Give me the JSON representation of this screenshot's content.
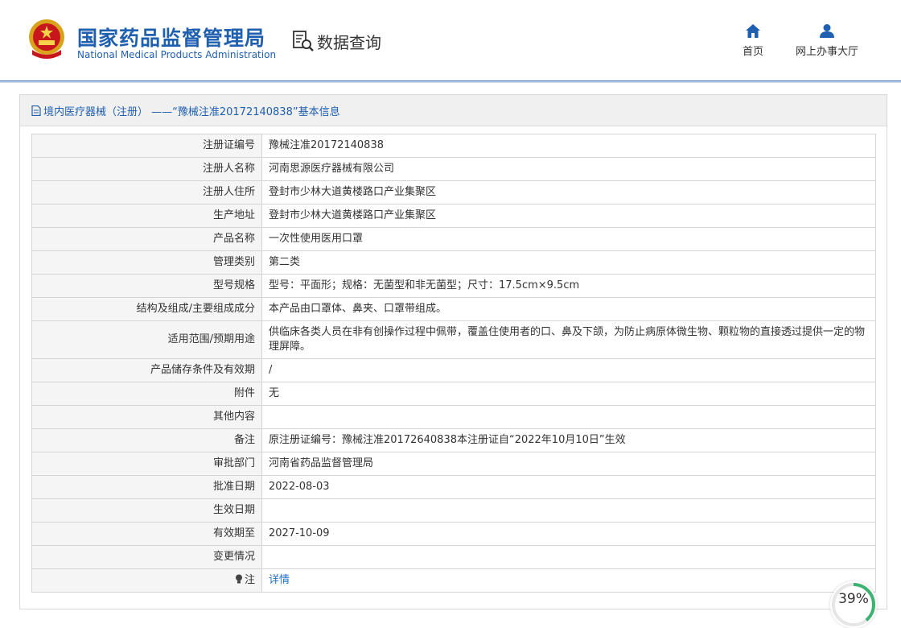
{
  "header": {
    "title_cn": "国家药品监督管理局",
    "title_en": "National Medical Products Administration",
    "section": "数据查询",
    "nav": [
      {
        "label": "首页",
        "icon": "home-icon"
      },
      {
        "label": "网上办事大厅",
        "icon": "user-icon"
      }
    ]
  },
  "panel": {
    "title": "境内医疗器械（注册） ——“豫械注准20172140838”基本信息"
  },
  "rows": [
    {
      "label": "注册证编号",
      "value": "豫械注准20172140838"
    },
    {
      "label": "注册人名称",
      "value": "河南思源医疗器械有限公司"
    },
    {
      "label": "注册人住所",
      "value": "登封市少林大道黄楼路口产业集聚区"
    },
    {
      "label": "生产地址",
      "value": "登封市少林大道黄楼路口产业集聚区"
    },
    {
      "label": "产品名称",
      "value": "一次性使用医用口罩"
    },
    {
      "label": "管理类别",
      "value": "第二类"
    },
    {
      "label": "型号规格",
      "value": "型号：平面形；规格：无菌型和非无菌型；尺寸：17.5cm×9.5cm"
    },
    {
      "label": "结构及组成/主要组成成分",
      "value": "本产品由口罩体、鼻夹、口罩带组成。"
    },
    {
      "label": "适用范围/预期用途",
      "value": "供临床各类人员在非有创操作过程中佩带，覆盖住使用者的口、鼻及下颌，为防止病原体微生物、颗粒物的直接透过提供一定的物理屏障。"
    },
    {
      "label": "产品储存条件及有效期",
      "value": "/"
    },
    {
      "label": "附件",
      "value": "无"
    },
    {
      "label": "其他内容",
      "value": ""
    },
    {
      "label": "备注",
      "value": "原注册证编号：豫械注准20172640838本注册证自“2022年10月10日”生效"
    },
    {
      "label": "审批部门",
      "value": "河南省药品监督管理局"
    },
    {
      "label": "批准日期",
      "value": "2022-08-03"
    },
    {
      "label": "生效日期",
      "value": ""
    },
    {
      "label": "有效期至",
      "value": "2027-10-09"
    },
    {
      "label": "变更情况",
      "value": ""
    }
  ],
  "note_row": {
    "label": "注",
    "link": "详情"
  },
  "progress": {
    "text": "39%",
    "value": 39
  },
  "colors": {
    "brand_blue": "#1f5fb0",
    "link_blue": "#1f6fc8",
    "progress_green": "#3cb371"
  }
}
